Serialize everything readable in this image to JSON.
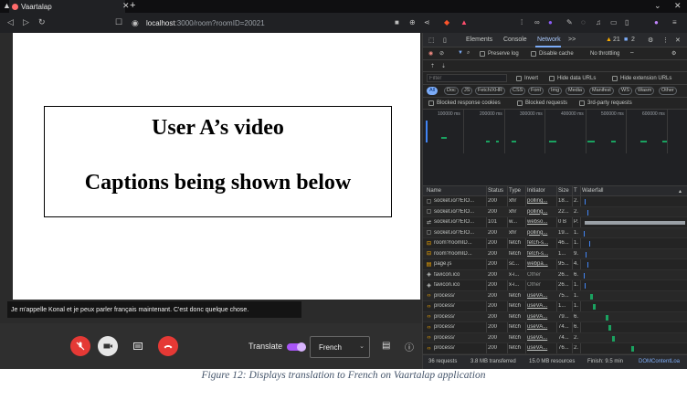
{
  "browser": {
    "tab_title": "Vaartalap",
    "new_tab_symbol": "+",
    "url_host": "localhost",
    "url_rest": ":3000/room?roomID=20021"
  },
  "video": {
    "line1": "User A’s video",
    "line2": "Captions being shown below"
  },
  "caption": "Je m'appelle Konal et je peux parler français maintenant. C'est donc quelque chose.",
  "controls": {
    "translate_label": "Translate",
    "translate_on": true,
    "language": "French"
  },
  "devtools": {
    "tabs": [
      "Elements",
      "Console",
      "Network"
    ],
    "more": ">>",
    "warnings": "21",
    "errors": "2",
    "preserve_log": "Preserve log",
    "disable_cache": "Disable cache",
    "throttling": "No throttling",
    "filter_placeholder": "Filter",
    "invert": "Invert",
    "hide_data_urls": "Hide data URLs",
    "hide_ext_urls": "Hide extension URLs",
    "type_filters": [
      "All",
      "Doc",
      "JS",
      "Fetch/XHR",
      "CSS",
      "Font",
      "Img",
      "Media",
      "Manifest",
      "WS",
      "Wasm",
      "Other"
    ],
    "blocked_cookies": "Blocked response cookies",
    "blocked_requests": "Blocked requests",
    "third_party": "3rd-party requests",
    "timeline_labels": [
      "100000 ms",
      "200000 ms",
      "300000 ms",
      "400000 ms",
      "500000 ms",
      "600000 ms"
    ],
    "columns": [
      "Name",
      "Status",
      "Type",
      "Initiator",
      "Size",
      "T",
      "Waterfall"
    ],
    "rows": [
      {
        "icon": "doc",
        "name": "socket.io/?EIO...",
        "status": "200",
        "type": "xhr",
        "initiator": "polling...",
        "size": "18...",
        "time": "2.",
        "wf_kind": "blue"
      },
      {
        "icon": "doc",
        "name": "socket.io/?EIO...",
        "status": "200",
        "type": "xhr",
        "initiator": "polling...",
        "size": "22...",
        "time": "2.",
        "wf_kind": "blue"
      },
      {
        "icon": "ws",
        "name": "socket.io/?EIO...",
        "status": "101",
        "type": "w...",
        "initiator": "webso...",
        "size": "0 B",
        "time": "P.",
        "wf_kind": "long"
      },
      {
        "icon": "doc",
        "name": "socket.io/?EIO...",
        "status": "200",
        "type": "xhr",
        "initiator": "polling...",
        "size": "19...",
        "time": "1.",
        "wf_kind": "blue"
      },
      {
        "icon": "fetch",
        "name": "room?roomID...",
        "status": "200",
        "type": "fetch",
        "initiator": "fetch-s...",
        "size": "46...",
        "time": "1.",
        "wf_kind": "blue"
      },
      {
        "icon": "fetch",
        "name": "room?roomID...",
        "status": "200",
        "type": "fetch",
        "initiator": "fetch-s...",
        "size": "1...",
        "time": "9.",
        "wf_kind": "blue"
      },
      {
        "icon": "js",
        "name": "page.js",
        "status": "200",
        "type": "sc...",
        "initiator": "webpa...",
        "size": "95...",
        "time": "4.",
        "wf_kind": "blue"
      },
      {
        "icon": "img",
        "name": "favicon.ico",
        "status": "200",
        "type": "x-i...",
        "initiator": "Other",
        "size": "26...",
        "time": "6.",
        "wf_kind": "blue"
      },
      {
        "icon": "img",
        "name": "favicon.ico",
        "status": "200",
        "type": "x-i...",
        "initiator": "Other",
        "size": "26...",
        "time": "1.",
        "wf_kind": "blue"
      },
      {
        "icon": "xhr",
        "name": "process/",
        "status": "200",
        "type": "fetch",
        "initiator": "useVA...",
        "size": "75...",
        "time": "1.",
        "wf_kind": "green"
      },
      {
        "icon": "xhr",
        "name": "process/",
        "status": "200",
        "type": "fetch",
        "initiator": "useVA...",
        "size": "1...",
        "time": "1.",
        "wf_kind": "green"
      },
      {
        "icon": "xhr",
        "name": "process/",
        "status": "200",
        "type": "fetch",
        "initiator": "useVA...",
        "size": "79...",
        "time": "6.",
        "wf_kind": "green"
      },
      {
        "icon": "xhr",
        "name": "process/",
        "status": "200",
        "type": "fetch",
        "initiator": "useVA...",
        "size": "74...",
        "time": "6.",
        "wf_kind": "green"
      },
      {
        "icon": "xhr",
        "name": "process/",
        "status": "200",
        "type": "fetch",
        "initiator": "useVA...",
        "size": "74...",
        "time": "2.",
        "wf_kind": "green"
      },
      {
        "icon": "xhr",
        "name": "process/",
        "status": "200",
        "type": "fetch",
        "initiator": "useVA...",
        "size": "76...",
        "time": "2.",
        "wf_kind": "green"
      },
      {
        "icon": "xhr",
        "name": "process/",
        "status": "200",
        "type": "fetch",
        "initiator": "useVA...",
        "size": "1...",
        "time": "2.",
        "wf_kind": "green"
      },
      {
        "icon": "xhr",
        "name": "process/",
        "status": "200",
        "type": "fetch",
        "initiator": "useVA...",
        "size": "85...",
        "time": "2.",
        "wf_kind": "green"
      },
      {
        "icon": "xhr",
        "name": "process/",
        "status": "200",
        "type": "fetch",
        "initiator": "useVA...",
        "size": "1...",
        "time": "2.",
        "wf_kind": "green"
      }
    ],
    "status_bar": {
      "requests": "36 requests",
      "transferred": "3.8 MB transferred",
      "resources": "15.0 MB resources",
      "finish": "Finish: 9.5 min",
      "dcl": "DOMContentLoa"
    }
  },
  "figure_caption": "Figure 12: Displays translation to French on Vaartalap application",
  "colors": {
    "accent_purple": "#a855f7",
    "end_call_red": "#e53935",
    "link_blue": "#7cacf8",
    "waterfall_green": "#1aa260",
    "waterfall_blue": "#4285f4"
  }
}
